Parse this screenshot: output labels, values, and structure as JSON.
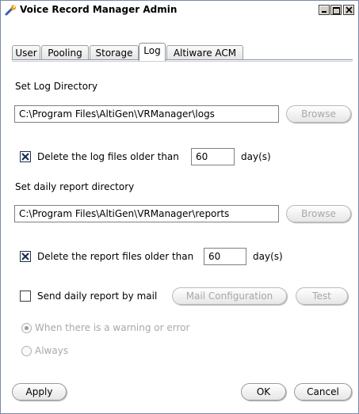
{
  "window": {
    "title": "Voice Record Manager Admin",
    "icon": "wrench-icon"
  },
  "tabs": [
    {
      "label": "User",
      "active": false
    },
    {
      "label": "Pooling",
      "active": false
    },
    {
      "label": "Storage",
      "active": false
    },
    {
      "label": "Log",
      "active": true
    },
    {
      "label": "Altiware ACM",
      "active": false
    }
  ],
  "log": {
    "set_dir_label": "Set Log Directory",
    "log_dir_value": "C:\\Program Files\\AltiGen\\VRManager\\logs",
    "browse_label": "Browse",
    "delete_logs_checked": true,
    "delete_logs_label": "Delete the log files older than",
    "delete_logs_days": "60",
    "days_unit": "day(s)"
  },
  "report": {
    "set_dir_label": "Set daily report directory",
    "report_dir_value": "C:\\Program Files\\AltiGen\\VRManager\\reports",
    "browse_label": "Browse",
    "delete_reports_checked": true,
    "delete_reports_label": "Delete the report files older than",
    "delete_reports_days": "60",
    "days_unit": "day(s)",
    "send_mail_checked": false,
    "send_mail_label": "Send daily report by mail",
    "mail_config_label": "Mail Configuration",
    "test_label": "Test",
    "radio_warning_label": "When there is a warning or error",
    "radio_warning_selected": true,
    "radio_always_label": "Always",
    "radio_always_selected": false
  },
  "footer": {
    "apply_label": "Apply",
    "ok_label": "OK",
    "cancel_label": "Cancel"
  }
}
